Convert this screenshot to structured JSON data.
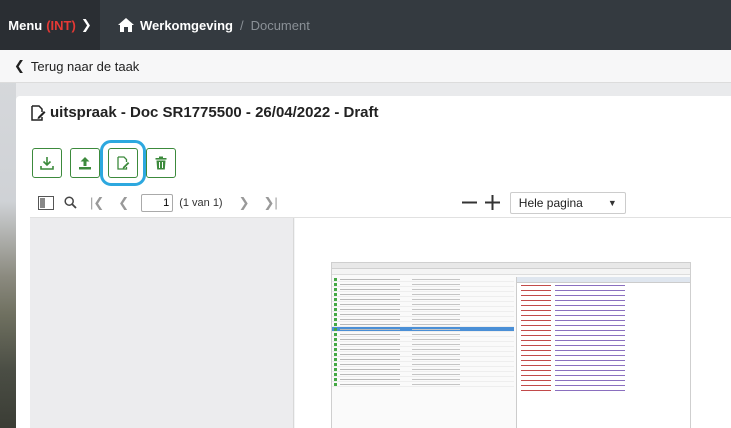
{
  "topbar": {
    "menu_label": "Menu",
    "env_badge": "(INT)",
    "breadcrumb": {
      "home": "Werkomgeving",
      "current": "Document"
    }
  },
  "back": {
    "label": "Terug naar de taak"
  },
  "card": {
    "title": "uitspraak - Doc SR1775500 - 26/04/2022 - Draft"
  },
  "toolbar": {
    "buttons": [
      {
        "icon": "download-icon"
      },
      {
        "icon": "upload-icon"
      },
      {
        "icon": "edit-document-icon",
        "highlighted": true
      },
      {
        "icon": "trash-icon"
      }
    ],
    "accent": "#3c8a3c",
    "highlight": "#2da8df"
  },
  "viewer": {
    "page_value": "1",
    "page_count": "(1 van 1)",
    "zoom": "Hele pagina"
  }
}
